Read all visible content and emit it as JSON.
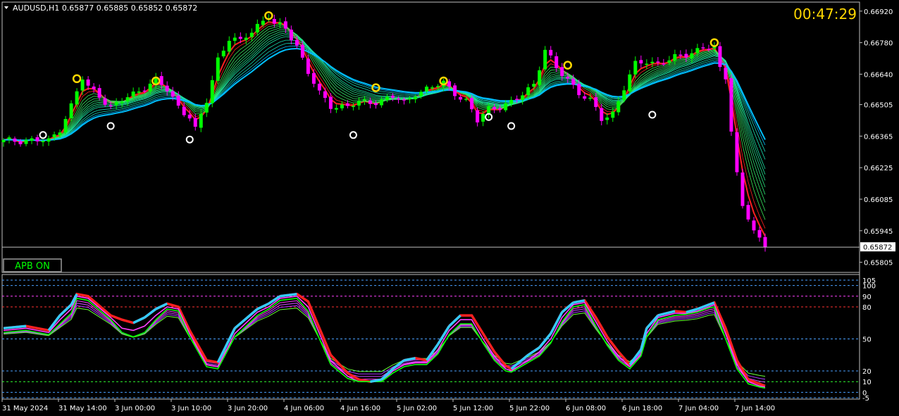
{
  "header": {
    "symbol_line": "AUDUSD,H1  0.65877 0.65885 0.65852 0.65872",
    "countdown": "00:47:29",
    "indicator_badge": "APB ON",
    "current_price_label": "0.65872"
  },
  "colors": {
    "background": "#000000",
    "bull_candle": "#00ff00",
    "bear_candle": "#ff00ff",
    "ma_fast": "#ff2020",
    "ma_slow": "#00bfff",
    "countdown": "#ffd700",
    "badge": "#00ff00"
  },
  "chart_data": [
    {
      "type": "candlestick",
      "title": "AUDUSD,H1",
      "y_ticks": [
        "0.66920",
        "0.66780",
        "0.66640",
        "0.66505",
        "0.66365",
        "0.66225",
        "0.66085",
        "0.65945",
        "0.65805"
      ],
      "y_tick_values": [
        0.6692,
        0.6678,
        0.6664,
        0.66505,
        0.66365,
        0.66225,
        0.66085,
        0.65945,
        0.65805
      ],
      "ylim": [
        0.6576,
        0.6696
      ],
      "last_price": 0.65872,
      "close_path": [
        {
          "x": 0,
          "close": 0.6634
        },
        {
          "x": 4,
          "close": 0.6635
        },
        {
          "x": 8,
          "close": 0.6634
        },
        {
          "x": 10,
          "close": 0.664
        },
        {
          "x": 12,
          "close": 0.665
        },
        {
          "x": 14,
          "close": 0.6662
        },
        {
          "x": 15,
          "close": 0.6658
        },
        {
          "x": 17,
          "close": 0.6655
        },
        {
          "x": 19,
          "close": 0.6649
        },
        {
          "x": 21,
          "close": 0.6652
        },
        {
          "x": 24,
          "close": 0.6657
        },
        {
          "x": 27,
          "close": 0.6661
        },
        {
          "x": 29,
          "close": 0.6657
        },
        {
          "x": 31,
          "close": 0.665
        },
        {
          "x": 33,
          "close": 0.6645
        },
        {
          "x": 34,
          "close": 0.6639
        },
        {
          "x": 36,
          "close": 0.6652
        },
        {
          "x": 38,
          "close": 0.6671
        },
        {
          "x": 40,
          "close": 0.668
        },
        {
          "x": 42,
          "close": 0.6678
        },
        {
          "x": 45,
          "close": 0.6686
        },
        {
          "x": 47,
          "close": 0.669
        },
        {
          "x": 48,
          "close": 0.6686
        },
        {
          "x": 50,
          "close": 0.6684
        },
        {
          "x": 52,
          "close": 0.6677
        },
        {
          "x": 54,
          "close": 0.6665
        },
        {
          "x": 56,
          "close": 0.6655
        },
        {
          "x": 58,
          "close": 0.665
        },
        {
          "x": 61,
          "close": 0.665
        },
        {
          "x": 63,
          "close": 0.6651
        },
        {
          "x": 66,
          "close": 0.6652
        },
        {
          "x": 69,
          "close": 0.6654
        },
        {
          "x": 71,
          "close": 0.6651
        },
        {
          "x": 73,
          "close": 0.6656
        },
        {
          "x": 76,
          "close": 0.6658
        },
        {
          "x": 78,
          "close": 0.666
        },
        {
          "x": 80,
          "close": 0.6656
        },
        {
          "x": 82,
          "close": 0.6652
        },
        {
          "x": 84,
          "close": 0.6643
        },
        {
          "x": 86,
          "close": 0.6649
        },
        {
          "x": 88,
          "close": 0.665
        },
        {
          "x": 90,
          "close": 0.6651
        },
        {
          "x": 92,
          "close": 0.6655
        },
        {
          "x": 94,
          "close": 0.666
        },
        {
          "x": 96,
          "close": 0.6675
        },
        {
          "x": 98,
          "close": 0.6666
        },
        {
          "x": 100,
          "close": 0.6662
        },
        {
          "x": 102,
          "close": 0.6656
        },
        {
          "x": 104,
          "close": 0.6652
        },
        {
          "x": 106,
          "close": 0.6644
        },
        {
          "x": 108,
          "close": 0.6647
        },
        {
          "x": 110,
          "close": 0.6658
        },
        {
          "x": 112,
          "close": 0.6668
        },
        {
          "x": 114,
          "close": 0.667
        },
        {
          "x": 116,
          "close": 0.6669
        },
        {
          "x": 118,
          "close": 0.667
        },
        {
          "x": 120,
          "close": 0.6672
        },
        {
          "x": 122,
          "close": 0.6674
        },
        {
          "x": 124,
          "close": 0.6676
        },
        {
          "x": 126,
          "close": 0.6675
        },
        {
          "x": 127,
          "close": 0.6666
        },
        {
          "x": 128,
          "close": 0.6663
        },
        {
          "x": 129,
          "close": 0.664
        },
        {
          "x": 130,
          "close": 0.662
        },
        {
          "x": 131,
          "close": 0.6605
        },
        {
          "x": 132,
          "close": 0.66
        },
        {
          "x": 133,
          "close": 0.6594
        },
        {
          "x": 134,
          "close": 0.659
        },
        {
          "x": 135,
          "close": 0.65872
        }
      ]
    },
    {
      "type": "line",
      "title": "oscillator",
      "y_ticks": [
        "105",
        "100",
        "90",
        "80",
        "50",
        "20",
        "10",
        "0",
        "-5"
      ],
      "levels": [
        105,
        100,
        90,
        80,
        50,
        20,
        10,
        0,
        -5
      ],
      "ylim": [
        -5,
        105
      ],
      "x": [
        0,
        4,
        6,
        8,
        10,
        12,
        13,
        15,
        19,
        21,
        23,
        25,
        27,
        29,
        31,
        33,
        36,
        38,
        41,
        45,
        47,
        49,
        52,
        54,
        56,
        58,
        61,
        63,
        65,
        67,
        69,
        71,
        73,
        75,
        77,
        79,
        81,
        83,
        85,
        87,
        89,
        90,
        93,
        95,
        97,
        99,
        101,
        103,
        105,
        107,
        109,
        111,
        113,
        114,
        116,
        119,
        121,
        123,
        125,
        126,
        128,
        130,
        132,
        134,
        135
      ],
      "series": [
        {
          "values": [
            60,
            62,
            60,
            58,
            72,
            82,
            92,
            90,
            72,
            68,
            65,
            70,
            78,
            83,
            80,
            58,
            30,
            28,
            60,
            78,
            83,
            90,
            92,
            85,
            60,
            35,
            18,
            12,
            10,
            12,
            22,
            30,
            32,
            30,
            45,
            62,
            72,
            72,
            55,
            38,
            25,
            22,
            35,
            42,
            55,
            75,
            84,
            86,
            70,
            52,
            38,
            26,
            40,
            60,
            72,
            76,
            75,
            78,
            82,
            84,
            60,
            30,
            12,
            8,
            6
          ]
        },
        {
          "values": [
            58,
            60,
            58,
            56,
            68,
            78,
            90,
            88,
            70,
            60,
            58,
            62,
            72,
            80,
            78,
            55,
            26,
            24,
            55,
            75,
            80,
            88,
            90,
            80,
            55,
            30,
            15,
            10,
            10,
            10,
            20,
            26,
            28,
            28,
            40,
            58,
            68,
            68,
            50,
            34,
            22,
            20,
            30,
            38,
            50,
            70,
            82,
            84,
            66,
            48,
            34,
            24,
            36,
            55,
            70,
            74,
            74,
            76,
            80,
            82,
            55,
            26,
            10,
            6,
            5
          ]
        },
        {
          "values": [
            56,
            58,
            56,
            54,
            64,
            74,
            88,
            86,
            68,
            56,
            52,
            56,
            68,
            78,
            76,
            52,
            24,
            22,
            52,
            72,
            78,
            86,
            88,
            76,
            50,
            26,
            13,
            10,
            10,
            10,
            18,
            24,
            26,
            26,
            36,
            54,
            64,
            64,
            46,
            30,
            20,
            19,
            28,
            34,
            46,
            66,
            80,
            82,
            62,
            44,
            30,
            22,
            34,
            52,
            68,
            72,
            73,
            75,
            79,
            80,
            50,
            22,
            8,
            5,
            4
          ]
        }
      ]
    }
  ],
  "time_axis": [
    "31 May 2024",
    "31 May 14:00",
    "3 Jun 00:00",
    "3 Jun 10:00",
    "3 Jun 20:00",
    "4 Jun 06:00",
    "4 Jun 16:00",
    "5 Jun 02:00",
    "5 Jun 12:00",
    "5 Jun 22:00",
    "6 Jun 08:00",
    "6 Jun 18:00",
    "7 Jun 04:00",
    "7 Jun 14:00"
  ]
}
